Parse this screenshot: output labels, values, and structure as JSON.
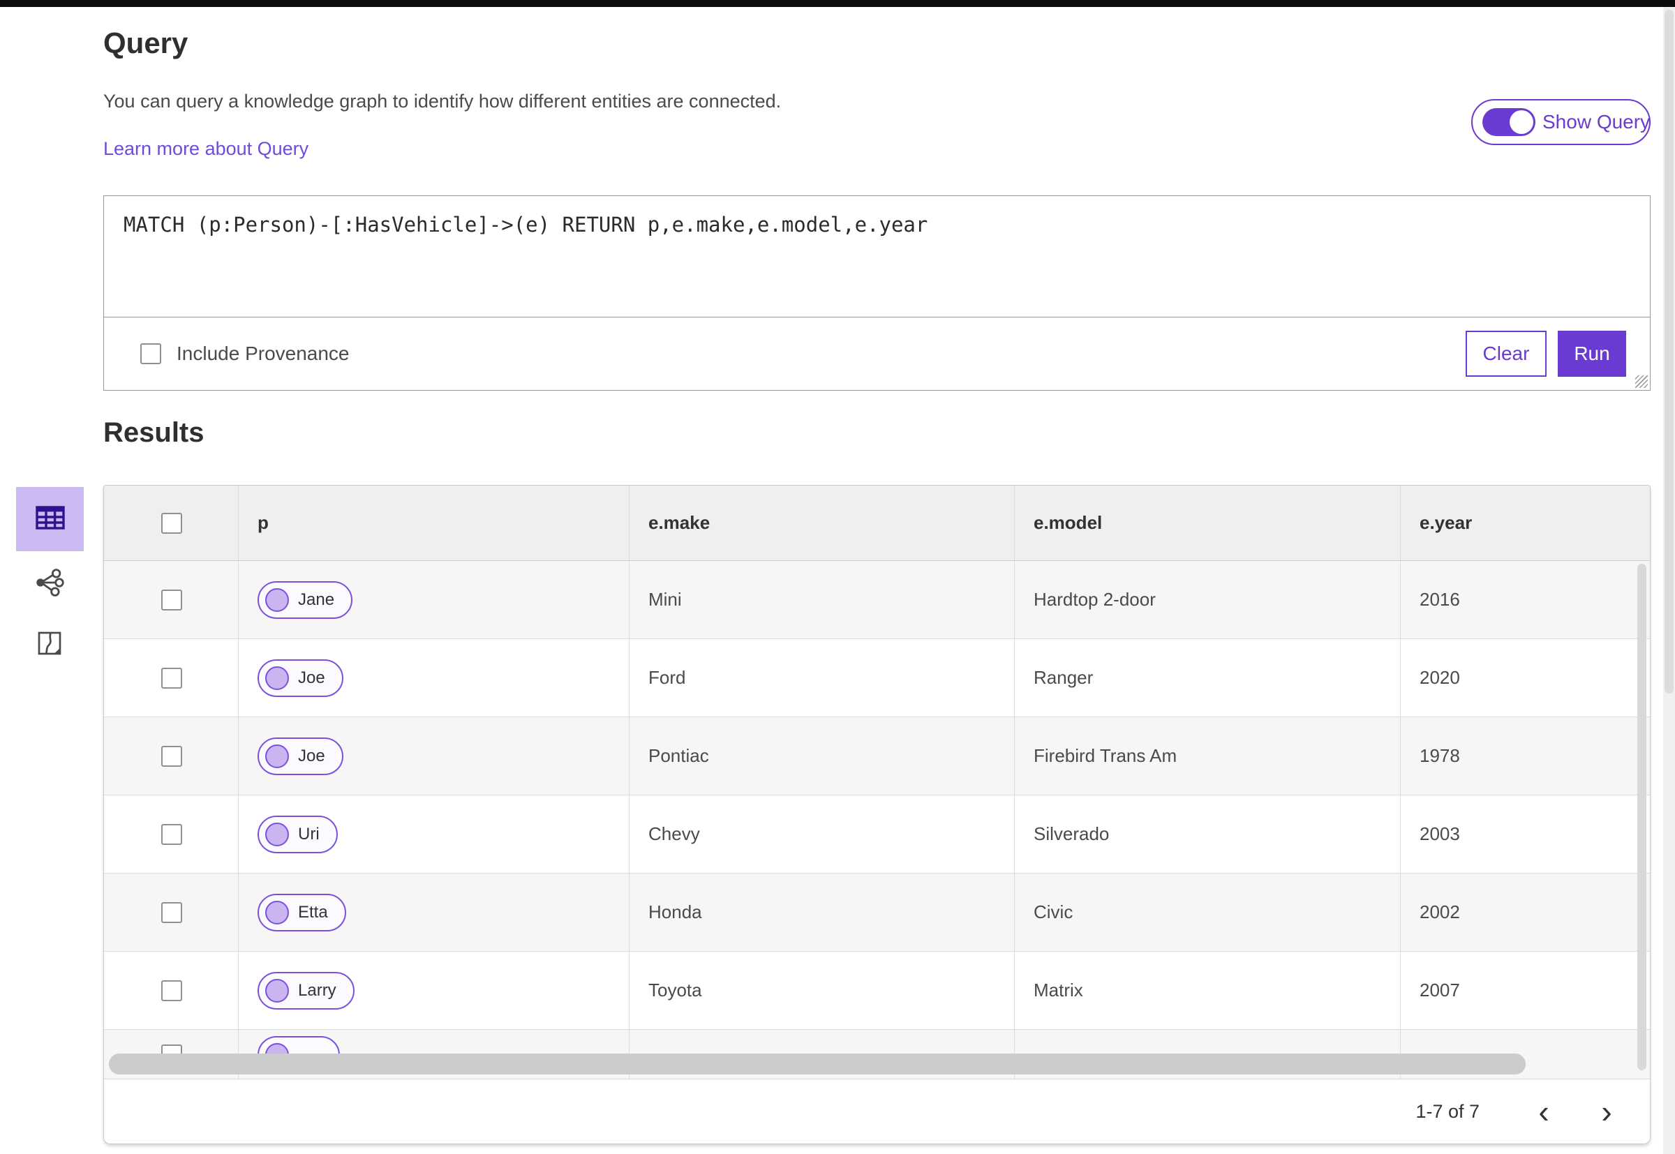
{
  "colors": {
    "accent": "#6a3bd1",
    "link": "#6f4bdb",
    "selected_icon_bg": "#cbb9f2",
    "icon_dark": "#2c128f",
    "pill_border": "#7b50dd",
    "pill_node_fill": "#cab5f1",
    "header_bg": "#efefef",
    "row_alt_bg": "#f6f6f6"
  },
  "query_section": {
    "title": "Query",
    "description": "You can query a knowledge graph to identify how different entities are connected.",
    "learn_more_link": "Learn more about Query",
    "show_query_toggle": {
      "label": "Show Query",
      "state": "on"
    },
    "query_input": {
      "value": "MATCH (p:Person)-[:HasVehicle]->(e) RETURN p,e.make,e.model,e.year"
    },
    "include_provenance": {
      "label": "Include Provenance",
      "checked": false
    },
    "buttons": {
      "clear": "Clear",
      "run": "Run"
    }
  },
  "results_section": {
    "title": "Results",
    "view_switcher": [
      {
        "name": "table-view",
        "icon": "table-icon",
        "selected": true
      },
      {
        "name": "link-chart-view",
        "icon": "link-chart-icon",
        "selected": false
      },
      {
        "name": "map-view",
        "icon": "map-icon",
        "selected": false
      }
    ],
    "table": {
      "columns": [
        "p",
        "e.make",
        "e.model",
        "e.year"
      ],
      "rows": [
        {
          "person": "Jane",
          "make": "Mini",
          "model": "Hardtop 2-door",
          "year": "2016",
          "partial": false
        },
        {
          "person": "Joe",
          "make": "Ford",
          "model": "Ranger",
          "year": "2020",
          "partial": false
        },
        {
          "person": "Joe",
          "make": "Pontiac",
          "model": "Firebird Trans Am",
          "year": "1978",
          "partial": false
        },
        {
          "person": "Uri",
          "make": "Chevy",
          "model": "Silverado",
          "year": "2003",
          "partial": false
        },
        {
          "person": "Etta",
          "make": "Honda",
          "model": "Civic",
          "year": "2002",
          "partial": false
        },
        {
          "person": "Larry",
          "make": "Toyota",
          "model": "Matrix",
          "year": "2007",
          "partial": false
        },
        {
          "person": "",
          "make": "",
          "model": "",
          "year": "",
          "partial": true
        }
      ]
    },
    "pagination": {
      "range_label": "1-7 of 7",
      "prev_icon": "‹",
      "next_icon": "›"
    }
  }
}
